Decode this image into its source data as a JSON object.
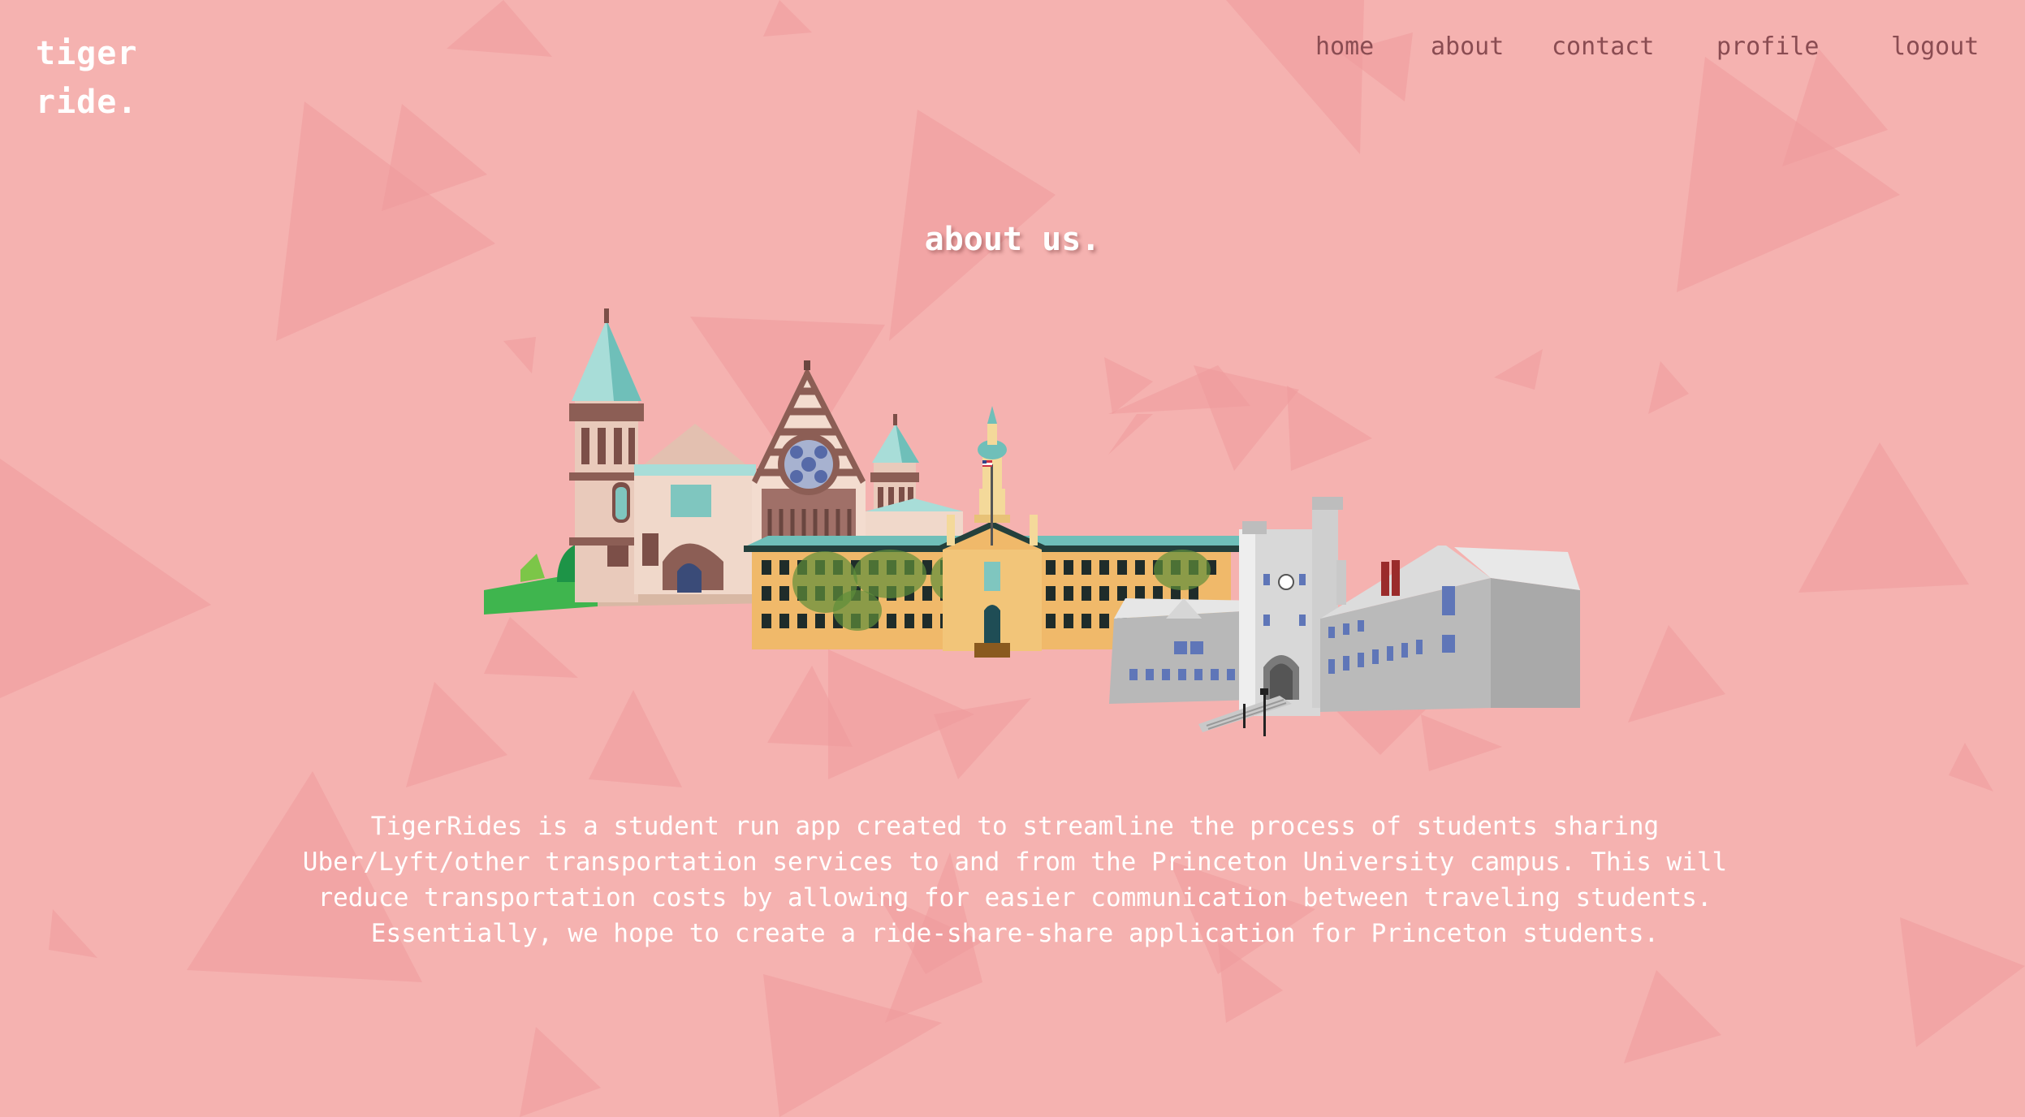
{
  "brand": {
    "line1": "tiger",
    "line2": "ride."
  },
  "nav": {
    "home": "home",
    "about": "about",
    "contact": "contact",
    "profile": "profile",
    "logout": "logout"
  },
  "page": {
    "title": "about us.",
    "description": "TigerRides is a student run app created to streamline the process of students sharing Uber/Lyft/other transportation services to and from the Princeton University campus. This will reduce transportation costs by allowing for easier communication between traveling students. Essentially, we hope to create a ride-share-share application for Princeton students."
  },
  "illustration": {
    "icon": "princeton-campus-illustration"
  },
  "colors": {
    "background": "#f5b2b0",
    "triangle": "#ee9a9c",
    "nav_text": "#8a4c52",
    "heading": "#ffffff"
  }
}
